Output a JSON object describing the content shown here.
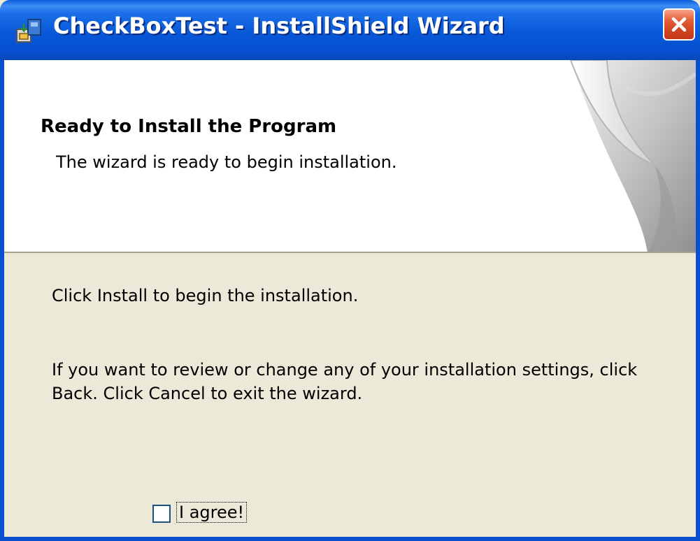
{
  "window": {
    "title": "CheckBoxTest - InstallShield Wizard"
  },
  "header": {
    "title": "Ready to Install the Program",
    "subtitle": "The wizard is ready to begin installation."
  },
  "body": {
    "instruction": "Click Install to begin the installation.",
    "info": "If you want to review or change any of your installation settings, click Back. Click Cancel to exit the wizard."
  },
  "checkbox": {
    "label": "I agree!",
    "checked": false
  },
  "icons": {
    "app": "installer-app-icon",
    "close": "close-icon",
    "banner": "page-curl-art"
  },
  "colors": {
    "titlebar": "#0858d8",
    "close_button": "#d14421",
    "dialog_background": "#ece9d8",
    "banner_background": "#ffffff"
  }
}
